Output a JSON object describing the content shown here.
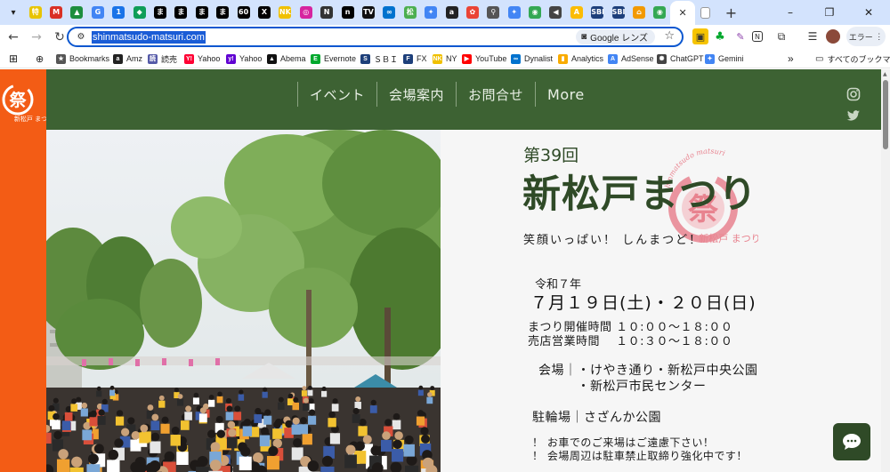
{
  "browser": {
    "tabs": [
      {
        "icon": "tab-icon-toku",
        "glyph": "特",
        "color": "#e8c400"
      },
      {
        "icon": "tab-icon-gmail",
        "glyph": "M",
        "color": "#d93025"
      },
      {
        "icon": "tab-icon-drive",
        "glyph": "▲",
        "color": "#1e8e3e"
      },
      {
        "icon": "tab-icon-google",
        "glyph": "G",
        "color": "#4285f4"
      },
      {
        "icon": "tab-icon-calendar",
        "glyph": "1",
        "color": "#1a73e8"
      },
      {
        "icon": "tab-icon-diamond",
        "glyph": "◆",
        "color": "#0f9d58"
      },
      {
        "icon": "tab-icon-ma-1",
        "glyph": "ま",
        "color": "#000000"
      },
      {
        "icon": "tab-icon-ma-2",
        "glyph": "ま",
        "color": "#000000"
      },
      {
        "icon": "tab-icon-ma-3",
        "glyph": "ま",
        "color": "#000000"
      },
      {
        "icon": "tab-icon-ma-4",
        "glyph": "ま",
        "color": "#000000"
      },
      {
        "icon": "tab-icon-60",
        "glyph": "60",
        "color": "#000000"
      },
      {
        "icon": "tab-icon-x",
        "glyph": "X",
        "color": "#000000"
      },
      {
        "icon": "tab-icon-nikkei",
        "glyph": "NK",
        "color": "#f0c000"
      },
      {
        "icon": "tab-icon-instagram",
        "glyph": "◎",
        "color": "#d6249f"
      },
      {
        "icon": "tab-icon-notion",
        "glyph": "N",
        "color": "#333333"
      },
      {
        "icon": "tab-icon-n",
        "glyph": "n",
        "color": "#000000"
      },
      {
        "icon": "tab-icon-news",
        "glyph": "TV",
        "color": "#111111"
      },
      {
        "icon": "tab-icon-infinity",
        "glyph": "∞",
        "color": "#0072ce"
      },
      {
        "icon": "tab-icon-leaf",
        "glyph": "松",
        "color": "#4caf50"
      },
      {
        "icon": "tab-icon-gemini-1",
        "glyph": "✦",
        "color": "#4285f4"
      },
      {
        "icon": "tab-icon-amazon",
        "glyph": "a",
        "color": "#222222"
      },
      {
        "icon": "tab-icon-photos",
        "glyph": "✿",
        "color": "#ea4335"
      },
      {
        "icon": "tab-icon-keep",
        "glyph": "⚲",
        "color": "#555555"
      },
      {
        "icon": "tab-icon-gemini-2",
        "glyph": "✦",
        "color": "#4285f4"
      },
      {
        "icon": "tab-icon-maps-1",
        "glyph": "◉",
        "color": "#34a853"
      },
      {
        "icon": "tab-icon-audio",
        "glyph": "◀",
        "color": "#444444"
      },
      {
        "icon": "tab-icon-adsense",
        "glyph": "A",
        "color": "#fbbc04"
      },
      {
        "icon": "tab-icon-sbi-1",
        "glyph": "SBI",
        "color": "#1d3f7a"
      },
      {
        "icon": "tab-icon-sbi-2",
        "glyph": "SBI",
        "color": "#1d3f7a"
      },
      {
        "icon": "tab-icon-orange",
        "glyph": "⌂",
        "color": "#f29900"
      },
      {
        "icon": "tab-icon-maps-2",
        "glyph": "◉",
        "color": "#34a853"
      }
    ],
    "active_tab": {
      "icon": "close-icon",
      "glyph": "✕"
    },
    "extra_tab": {
      "icon": "blank-page-icon"
    },
    "new_tab": "+",
    "window_controls": {
      "minimize": "–",
      "restore": "❐",
      "close": "✕"
    },
    "url": "shinmatsudo-matsuri.com",
    "lens_label": "Google レンズ",
    "error_label": "エラー",
    "bookmarks": [
      {
        "name": "bookmark-bookmarks",
        "label": "Bookmarks",
        "icon": "★",
        "color": "#555555"
      },
      {
        "name": "bookmark-amz",
        "label": "Amz",
        "icon": "a",
        "color": "#222222"
      },
      {
        "name": "bookmark-yomiuri",
        "label": "読売",
        "icon": "読",
        "color": "#555aa8"
      },
      {
        "name": "bookmark-yahoo-1",
        "label": "Yahoo",
        "icon": "Y!",
        "color": "#ff0033"
      },
      {
        "name": "bookmark-yahoo-2",
        "label": "Yahoo",
        "icon": "y!",
        "color": "#6001d2"
      },
      {
        "name": "bookmark-abema",
        "label": "Abema",
        "icon": "▲",
        "color": "#111111"
      },
      {
        "name": "bookmark-evernote",
        "label": "Evernote",
        "icon": "E",
        "color": "#00a82d"
      },
      {
        "name": "bookmark-sbi",
        "label": "ＳＢＩ",
        "icon": "S",
        "color": "#1d3f7a"
      },
      {
        "name": "bookmark-fx",
        "label": "FX",
        "icon": "F",
        "color": "#1d3f7a"
      },
      {
        "name": "bookmark-ny",
        "label": "NY",
        "icon": "NK",
        "color": "#f0c000"
      },
      {
        "name": "bookmark-youtube",
        "label": "YouTube",
        "icon": "▶",
        "color": "#ff0000"
      },
      {
        "name": "bookmark-dynalist",
        "label": "Dynalist",
        "icon": "∞",
        "color": "#0072ce"
      },
      {
        "name": "bookmark-analytics",
        "label": "Analytics",
        "icon": "▮",
        "color": "#f9ab00"
      },
      {
        "name": "bookmark-adsense",
        "label": "AdSense",
        "icon": "A",
        "color": "#4285f4"
      },
      {
        "name": "bookmark-chatgpt",
        "label": "ChatGPT",
        "icon": "✺",
        "color": "#444444"
      },
      {
        "name": "bookmark-gemini",
        "label": "Gemini",
        "icon": "✦",
        "color": "#4285f4"
      }
    ],
    "bookmarks_overflow": "»",
    "all_bookmarks": "すべてのブックマーク"
  },
  "site": {
    "logo_text": "祭",
    "logo_caption": "新松戸 まつり",
    "nav": [
      "イベント",
      "会場案内",
      "お問合せ",
      "More"
    ],
    "social": {
      "instagram": "instagram-icon",
      "twitter": "twitter-icon"
    },
    "hero": {
      "edition": "第39回",
      "title": "新松戸まつり",
      "stamp_arc_text": "shinmatsudo matsuri",
      "stamp_char": "祭",
      "stamp_caption": "新松戸 まつり",
      "tagline": "笑顔いっぱい！ しんまつど！",
      "era": "令和７年",
      "dates": "７月１９日(土)・２０日(日)",
      "hours": "まつり開催時間 １０:００～１８:００\n売店営業時間　 １０:３０～１８:００",
      "venue": "会場｜・けやき通り・新松戸中央公園\n　　　・新松戸市民センター",
      "bike": "駐輪場｜さざんか公園",
      "notice": "！ お車でのご来場はご遠慮下さい！\n！ 会場周辺は駐車禁止取締り強化中です！"
    },
    "colors": {
      "header": "#3d6233",
      "sidebar": "#f35c15",
      "title": "#2f4a27",
      "stamp": "#e8838f"
    }
  }
}
